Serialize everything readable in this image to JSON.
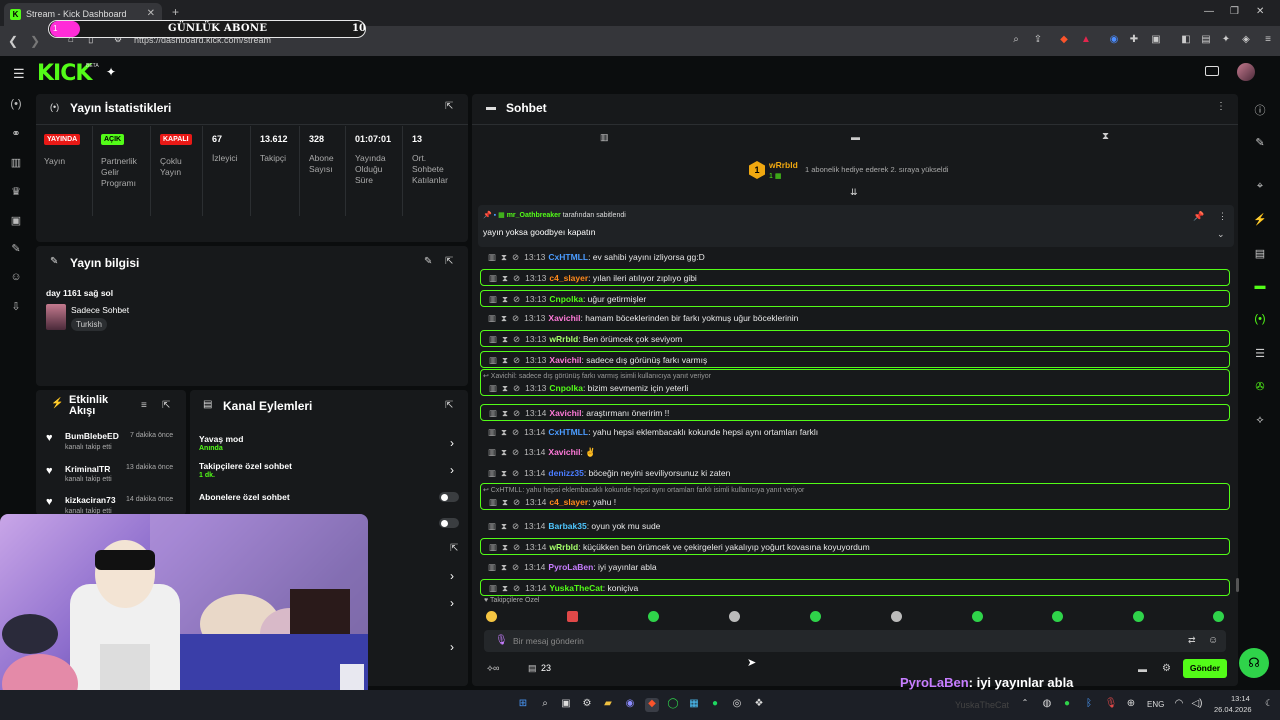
{
  "browser": {
    "tab_title": "Stream - Kick Dashboard",
    "url": "https://dashboard.kick.com/stream"
  },
  "overlay": {
    "sub_goal_title": "GÜNLÜK ABONE",
    "sub_goal_current": "1",
    "sub_goal_target": "10",
    "chat_echo_user": "PyroLaBen",
    "chat_echo_text": ": iyi yayınlar abla",
    "watermark": "YuskaTheCat"
  },
  "app": {
    "logo": "KICK",
    "beta": "BETA"
  },
  "stats": {
    "title": "Yayın İstatistikleri",
    "cells": [
      {
        "badge": "YAYINDA",
        "label": "Yayın",
        "badge_color": "#e91916"
      },
      {
        "badge": "AÇIK",
        "label": "Partnerlik Gelir Programı",
        "badge_color": "#53fc18"
      },
      {
        "badge": "KAPALI",
        "label": "Çoklu Yayın",
        "badge_color": "#e91916"
      },
      {
        "value": "67",
        "label": "İzleyici"
      },
      {
        "value": "13.612",
        "label": "Takipçi"
      },
      {
        "value": "328",
        "label": "Abone Sayısı"
      },
      {
        "value": "01:07:01",
        "label": "Yayında Olduğu Süre"
      },
      {
        "value": "13",
        "label": "Ort. Sohbete Katılanlar"
      }
    ]
  },
  "info": {
    "title": "Yayın bilgisi",
    "stream_title": "day 1161 sağ sol",
    "category": "Sadece Sohbet",
    "tag": "Turkish"
  },
  "activity": {
    "title": "Etkinlik Akışı",
    "items": [
      {
        "user": "BumBlebeED",
        "action": "kanalı takip etti",
        "time": "7 dakika önce"
      },
      {
        "user": "KriminalTR",
        "action": "kanalı takip etti",
        "time": "13 dakika önce"
      },
      {
        "user": "kizkaciran73",
        "action": "kanalı takip etti",
        "time": "14 dakika önce"
      }
    ]
  },
  "actions": {
    "title": "Kanal Eylemleri",
    "items": [
      {
        "label": "Yavaş mod",
        "sub": "Anında"
      },
      {
        "label": "Takipçilere özel sohbet",
        "sub": "1 dk."
      },
      {
        "label": "Abonelere özel sohbet",
        "sub": ""
      }
    ]
  },
  "chat": {
    "title": "Sohbet",
    "top_gifter": "wRrbld",
    "top_gifter_rank": "1",
    "gift_notice": "1 abonelik hediye ederek 2. sıraya yükseldi",
    "pinned_by": "mr_Oathbreaker",
    "pinned_suffix": "tarafından sabitlendi",
    "pinned_text": "yayın yoksa goodbyeı kapatın",
    "messages": [
      {
        "time": "13:13",
        "user": "CxHTMLL",
        "color": "#4b9cff",
        "text": ": ev sahibi yayını izliyorsa gg:D",
        "hl": false
      },
      {
        "time": "13:13",
        "user": "c4_slayer",
        "color": "#ff8a1c",
        "text": ": yılan ileri atılıyor zıplıyo gibi",
        "hl": true
      },
      {
        "time": "13:13",
        "user": "Cnpolka",
        "color": "#53fc18",
        "text": ": uğur getirmişler",
        "hl": true
      },
      {
        "time": "13:13",
        "user": "Xavichil",
        "color": "#ff7ad9",
        "text": ": hamam böceklerinden bir farkı yokmuş uğur böceklerinin",
        "hl": false
      },
      {
        "time": "13:13",
        "user": "wRrbld",
        "color": "#a6ff6b",
        "text": ": Ben örümcek çok seviyom",
        "hl": true
      },
      {
        "time": "13:13",
        "user": "Xavichil",
        "color": "#ff7ad9",
        "text": ": sadece dış görünüş farkı varmış",
        "hl": true
      },
      {
        "time": "13:13",
        "user": "Cnpolka",
        "color": "#53fc18",
        "text": ": bizim sevmemiz için yeterli",
        "hl": true,
        "reply": "Xavichil: sadece dış görünüş farkı varmış isimli kullanıcıya yanıt veriyor"
      },
      {
        "time": "13:14",
        "user": "Xavichil",
        "color": "#ff7ad9",
        "text": ": araştırmanı öneririm !!",
        "hl": true
      },
      {
        "time": "13:14",
        "user": "CxHTMLL",
        "color": "#4b9cff",
        "text": ": yahu hepsi eklembacaklı kokunde hepsi aynı ortamları farklı",
        "hl": false
      },
      {
        "time": "13:14",
        "user": "Xavichil",
        "color": "#ff7ad9",
        "text": ": ✌",
        "hl": false
      },
      {
        "time": "13:14",
        "user": "denizz35",
        "color": "#4b7dff",
        "text": ": böceğin neyini seviliyorsunuz ki zaten",
        "hl": false
      },
      {
        "time": "13:14",
        "user": "c4_slayer",
        "color": "#ff8a1c",
        "text": ": yahu !",
        "hl": true,
        "reply": "CxHTMLL: yahu hepsi eklembacaklı kokunde hepsi aynı ortamları farklı isimli kullanıcıya yanıt veriyor"
      },
      {
        "time": "13:14",
        "user": "Barbak35",
        "color": "#4fc7ff",
        "text": ": oyun yok mu sude",
        "hl": false
      },
      {
        "time": "13:14",
        "user": "wRrbld",
        "color": "#a6ff6b",
        "text": ": küçükken ben örümcek ve çekirgeleri yakalıyıp yoğurt kovasına koyuyordum",
        "hl": true
      },
      {
        "time": "13:14",
        "user": "PyroLaBen",
        "color": "#c77dff",
        "text": ": iyi yayınlar abla",
        "hl": false
      },
      {
        "time": "13:14",
        "user": "YuskaTheCat",
        "color": "#53fc18",
        "text": ": koniçiva",
        "hl": true
      }
    ],
    "mode_label": "Takipçilere Özel",
    "input_placeholder": "Bir mesaj gönderin",
    "viewer_icon_count": "23",
    "send_label": "Gönder"
  },
  "taskbar": {
    "lang": "ENG",
    "time": "13:14",
    "date": "26.04.2026"
  }
}
